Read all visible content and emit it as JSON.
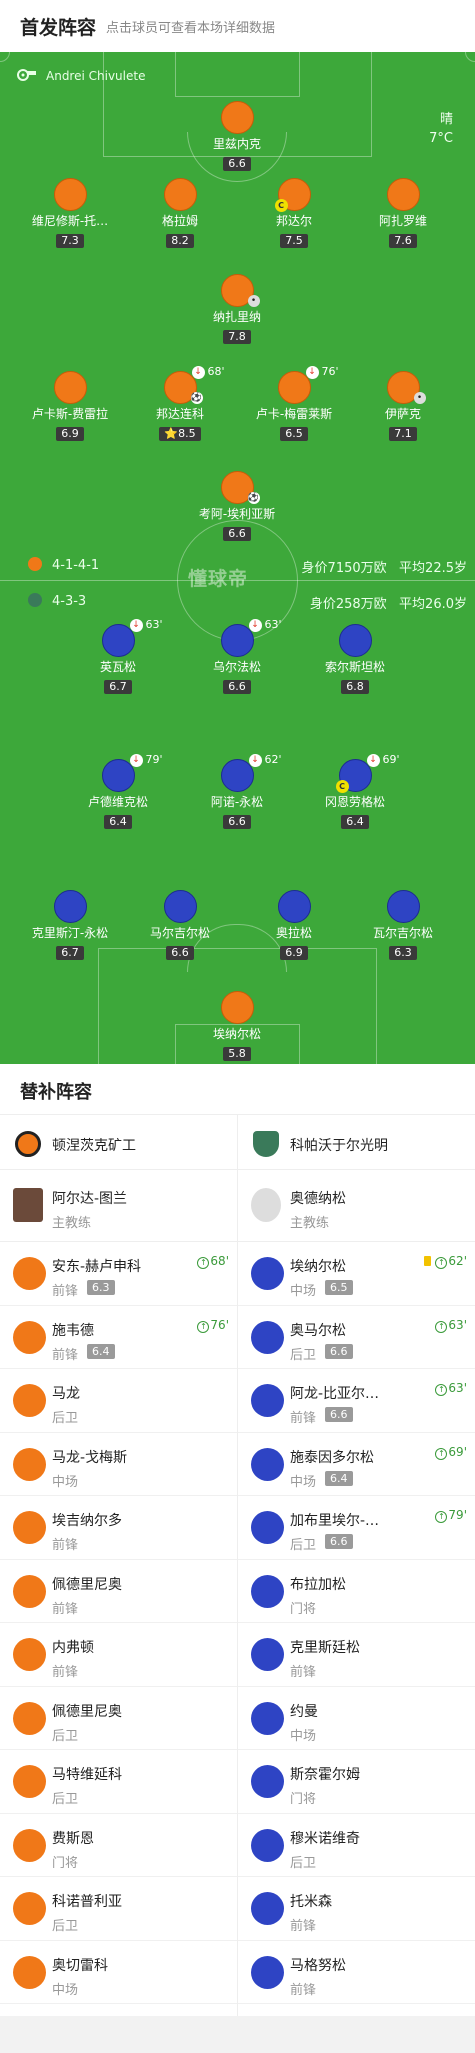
{
  "header": {
    "title": "首发阵容",
    "subtitle": "点击球员可查看本场详细数据"
  },
  "referee": {
    "icon": "whistle-icon",
    "name": "Andrei Chivulete"
  },
  "weather": {
    "condition": "晴",
    "temperature": "7°C"
  },
  "watermark": "懂球帝",
  "home": {
    "formation": "4-1-4-1",
    "value": "身价7150万欧",
    "avg_age": "平均22.5岁",
    "players": [
      {
        "name": "里兹内克",
        "rating": "6.6"
      },
      {
        "name": "维尼修斯-托…",
        "rating": "7.3"
      },
      {
        "name": "格拉姆",
        "rating": "8.2"
      },
      {
        "name": "邦达尔",
        "rating": "7.5",
        "captain": "C"
      },
      {
        "name": "阿扎罗维",
        "rating": "7.6"
      },
      {
        "name": "纳扎里纳",
        "rating": "7.8"
      },
      {
        "name": "卢卡斯-费雷拉",
        "rating": "6.9"
      },
      {
        "name": "邦达连科",
        "rating": "⭐8.5",
        "sub_time": "68'"
      },
      {
        "name": "卢卡-梅雷莱斯",
        "rating": "6.5",
        "sub_time": "76'"
      },
      {
        "name": "伊萨克",
        "rating": "7.1"
      },
      {
        "name": "考阿-埃利亚斯",
        "rating": "6.6"
      }
    ]
  },
  "away": {
    "formation": "4-3-3",
    "value": "身价258万欧",
    "avg_age": "平均26.0岁",
    "players": [
      {
        "name": "英瓦松",
        "rating": "6.7",
        "sub_time": "63'"
      },
      {
        "name": "乌尔法松",
        "rating": "6.6",
        "sub_time": "63'"
      },
      {
        "name": "索尔斯坦松",
        "rating": "6.8"
      },
      {
        "name": "卢德维克松",
        "rating": "6.4",
        "sub_time": "79'"
      },
      {
        "name": "阿诺-永松",
        "rating": "6.6",
        "sub_time": "62'"
      },
      {
        "name": "冈恩劳格松",
        "rating": "6.4",
        "sub_time": "69'",
        "captain": "C"
      },
      {
        "name": "克里斯汀-永松",
        "rating": "6.7"
      },
      {
        "name": "马尔吉尔松",
        "rating": "6.6"
      },
      {
        "name": "奥拉松",
        "rating": "6.9"
      },
      {
        "name": "瓦尔吉尔松",
        "rating": "6.3"
      },
      {
        "name": "埃纳尔松",
        "rating": "5.8"
      }
    ]
  },
  "subs_title": "替补阵容",
  "teams": {
    "home": "顿涅茨克矿工",
    "away": "科帕沃于尔光明"
  },
  "coaches": {
    "home": {
      "name": "阿尔达-图兰",
      "role": "主教练"
    },
    "away": {
      "name": "奥德纳松",
      "role": "主教练"
    }
  },
  "subs_home": [
    {
      "name": "安东-赫卢申科",
      "pos": "前锋",
      "rating": "6.3",
      "time": "68'"
    },
    {
      "name": "施韦德",
      "pos": "前锋",
      "rating": "6.4",
      "time": "76'"
    },
    {
      "name": "马龙",
      "pos": "后卫"
    },
    {
      "name": "马龙-戈梅斯",
      "pos": "中场"
    },
    {
      "name": "埃吉纳尔多",
      "pos": "前锋"
    },
    {
      "name": "佩德里尼奥",
      "pos": "前锋"
    },
    {
      "name": "内弗顿",
      "pos": "前锋"
    },
    {
      "name": "佩德里尼奥",
      "pos": "后卫"
    },
    {
      "name": "马特维延科",
      "pos": "后卫"
    },
    {
      "name": "费斯恩",
      "pos": "门将"
    },
    {
      "name": "科诺普利亚",
      "pos": "后卫"
    },
    {
      "name": "奥切雷科",
      "pos": "中场"
    }
  ],
  "subs_away": [
    {
      "name": "埃纳尔松",
      "pos": "中场",
      "rating": "6.5",
      "time": "62'",
      "yellow": true
    },
    {
      "name": "奥马尔松",
      "pos": "后卫",
      "rating": "6.6",
      "time": "63'"
    },
    {
      "name": "阿龙-比亚尔…",
      "pos": "前锋",
      "rating": "6.6",
      "time": "63'"
    },
    {
      "name": "施泰因多尔松",
      "pos": "中场",
      "rating": "6.4",
      "time": "69'"
    },
    {
      "name": "加布里埃尔-…",
      "pos": "后卫",
      "rating": "6.6",
      "time": "79'"
    },
    {
      "name": "布拉加松",
      "pos": "门将"
    },
    {
      "name": "克里斯廷松",
      "pos": "前锋"
    },
    {
      "name": "约曼",
      "pos": "中场"
    },
    {
      "name": "斯奈霍尔姆",
      "pos": "门将"
    },
    {
      "name": "穆米诺维奇",
      "pos": "后卫"
    },
    {
      "name": "托米森",
      "pos": "前锋"
    },
    {
      "name": "马格努松",
      "pos": "前锋"
    }
  ],
  "colors": {
    "home": "#f07818",
    "away": "#2e44c4",
    "pitch": "#3da83a"
  }
}
